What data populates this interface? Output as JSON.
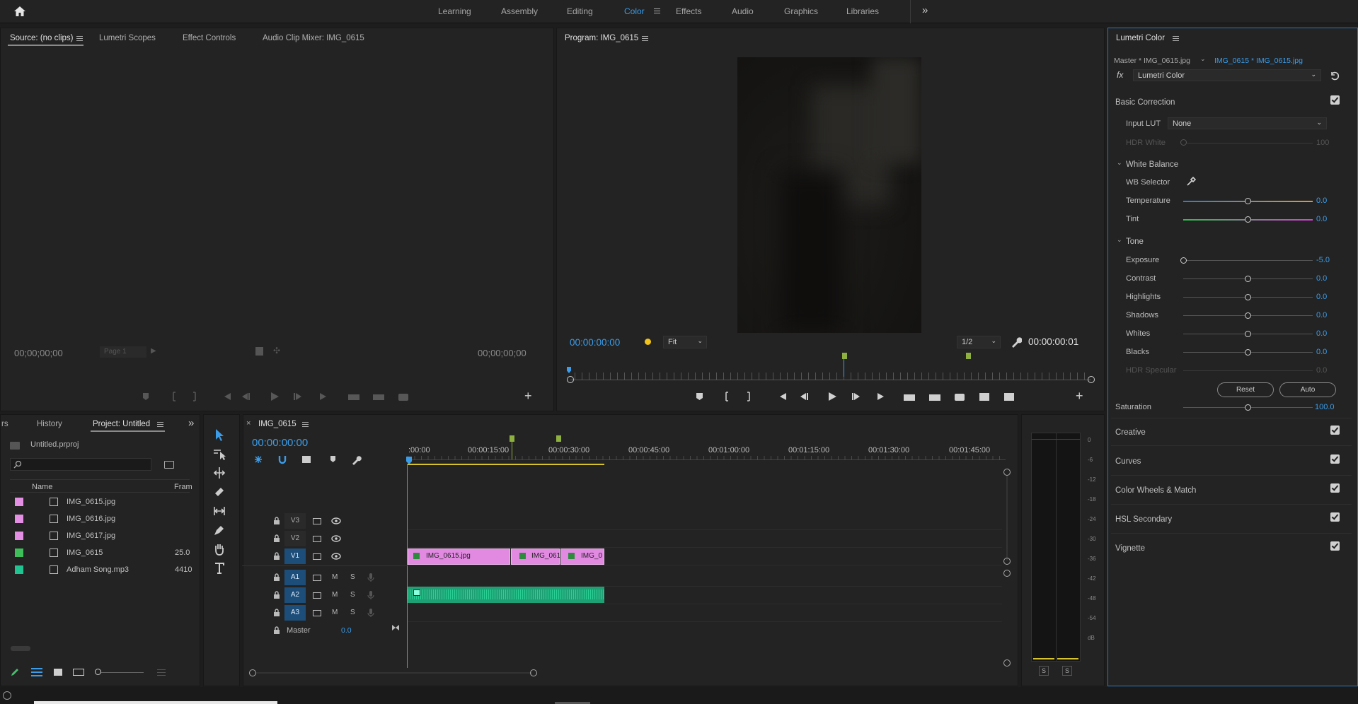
{
  "workspaces": [
    "Learning",
    "Assembly",
    "Editing",
    "Color",
    "Effects",
    "Audio",
    "Graphics",
    "Libraries"
  ],
  "active_workspace": "Color",
  "source_panel": {
    "tabs": [
      "Source: (no clips)",
      "Lumetri Scopes",
      "Effect Controls",
      "Audio Clip Mixer: IMG_0615"
    ],
    "tc_in": "00;00;00;00",
    "tc_out": "00;00;00;00",
    "page": "Page 1"
  },
  "program_panel": {
    "title": "Program: IMG_0615",
    "timecode": "00:00:00:00",
    "fit": "Fit",
    "resolution": "1/2",
    "duration": "00:00:00:01"
  },
  "lumetri": {
    "title": "Lumetri Color",
    "master": "Master * IMG_0615.jpg",
    "clip": "IMG_0615 * IMG_0615.jpg",
    "fx_label": "fx",
    "effect": "Lumetri Color",
    "basic_correction": "Basic Correction",
    "input_lut_label": "Input LUT",
    "input_lut_value": "None",
    "hdr_white_label": "HDR White",
    "hdr_white_value": "100",
    "white_balance": "White Balance",
    "wb_selector": "WB Selector",
    "temperature_label": "Temperature",
    "temperature_value": "0.0",
    "tint_label": "Tint",
    "tint_value": "0.0",
    "tone": "Tone",
    "exposure_label": "Exposure",
    "exposure_value": "-5.0",
    "contrast_label": "Contrast",
    "contrast_value": "0.0",
    "highlights_label": "Highlights",
    "highlights_value": "0.0",
    "shadows_label": "Shadows",
    "shadows_value": "0.0",
    "whites_label": "Whites",
    "whites_value": "0.0",
    "blacks_label": "Blacks",
    "blacks_value": "0.0",
    "hdr_specular_label": "HDR Specular",
    "hdr_specular_value": "0.0",
    "reset": "Reset",
    "auto": "Auto",
    "saturation_label": "Saturation",
    "saturation_value": "100.0",
    "creative": "Creative",
    "curves": "Curves",
    "color_wheels": "Color Wheels & Match",
    "hsl": "HSL Secondary",
    "vignette": "Vignette"
  },
  "project_panel": {
    "tabs": [
      "rs",
      "History",
      "Project: Untitled"
    ],
    "file": "Untitled.prproj",
    "col_name": "Name",
    "col_fram": "Fram",
    "items": [
      {
        "name": "IMG_0615.jpg",
        "fps": "",
        "color": "#e48ee4"
      },
      {
        "name": "IMG_0616.jpg",
        "fps": "",
        "color": "#e48ee4"
      },
      {
        "name": "IMG_0617.jpg",
        "fps": "",
        "color": "#e48ee4"
      },
      {
        "name": "IMG_0615",
        "fps": "25.0",
        "color": "#3fbf5a"
      },
      {
        "name": "Adham Song.mp3",
        "fps": "4410",
        "color": "#20c490"
      }
    ]
  },
  "timeline": {
    "tab": "IMG_0615",
    "timecode": "00:00:00:00",
    "ruler": [
      ":00:00",
      "00:00:15:00",
      "00:00:30:00",
      "00:00:45:00",
      "00:01:00:00",
      "00:01:15:00",
      "00:01:30:00",
      "00:01:45:00"
    ],
    "video_tracks": [
      "V3",
      "V2",
      "V1"
    ],
    "audio_tracks": [
      "A1",
      "A2",
      "A3"
    ],
    "master": "Master",
    "master_value": "0.0",
    "clips": [
      "IMG_0615.jpg",
      "IMG_061",
      "IMG_0"
    ],
    "m": "M",
    "s": "S"
  },
  "meter": {
    "scale": [
      "0",
      "-6",
      "-12",
      "-18",
      "-24",
      "-30",
      "-36",
      "-42",
      "-48",
      "-54",
      "dB"
    ],
    "solo": "S"
  }
}
